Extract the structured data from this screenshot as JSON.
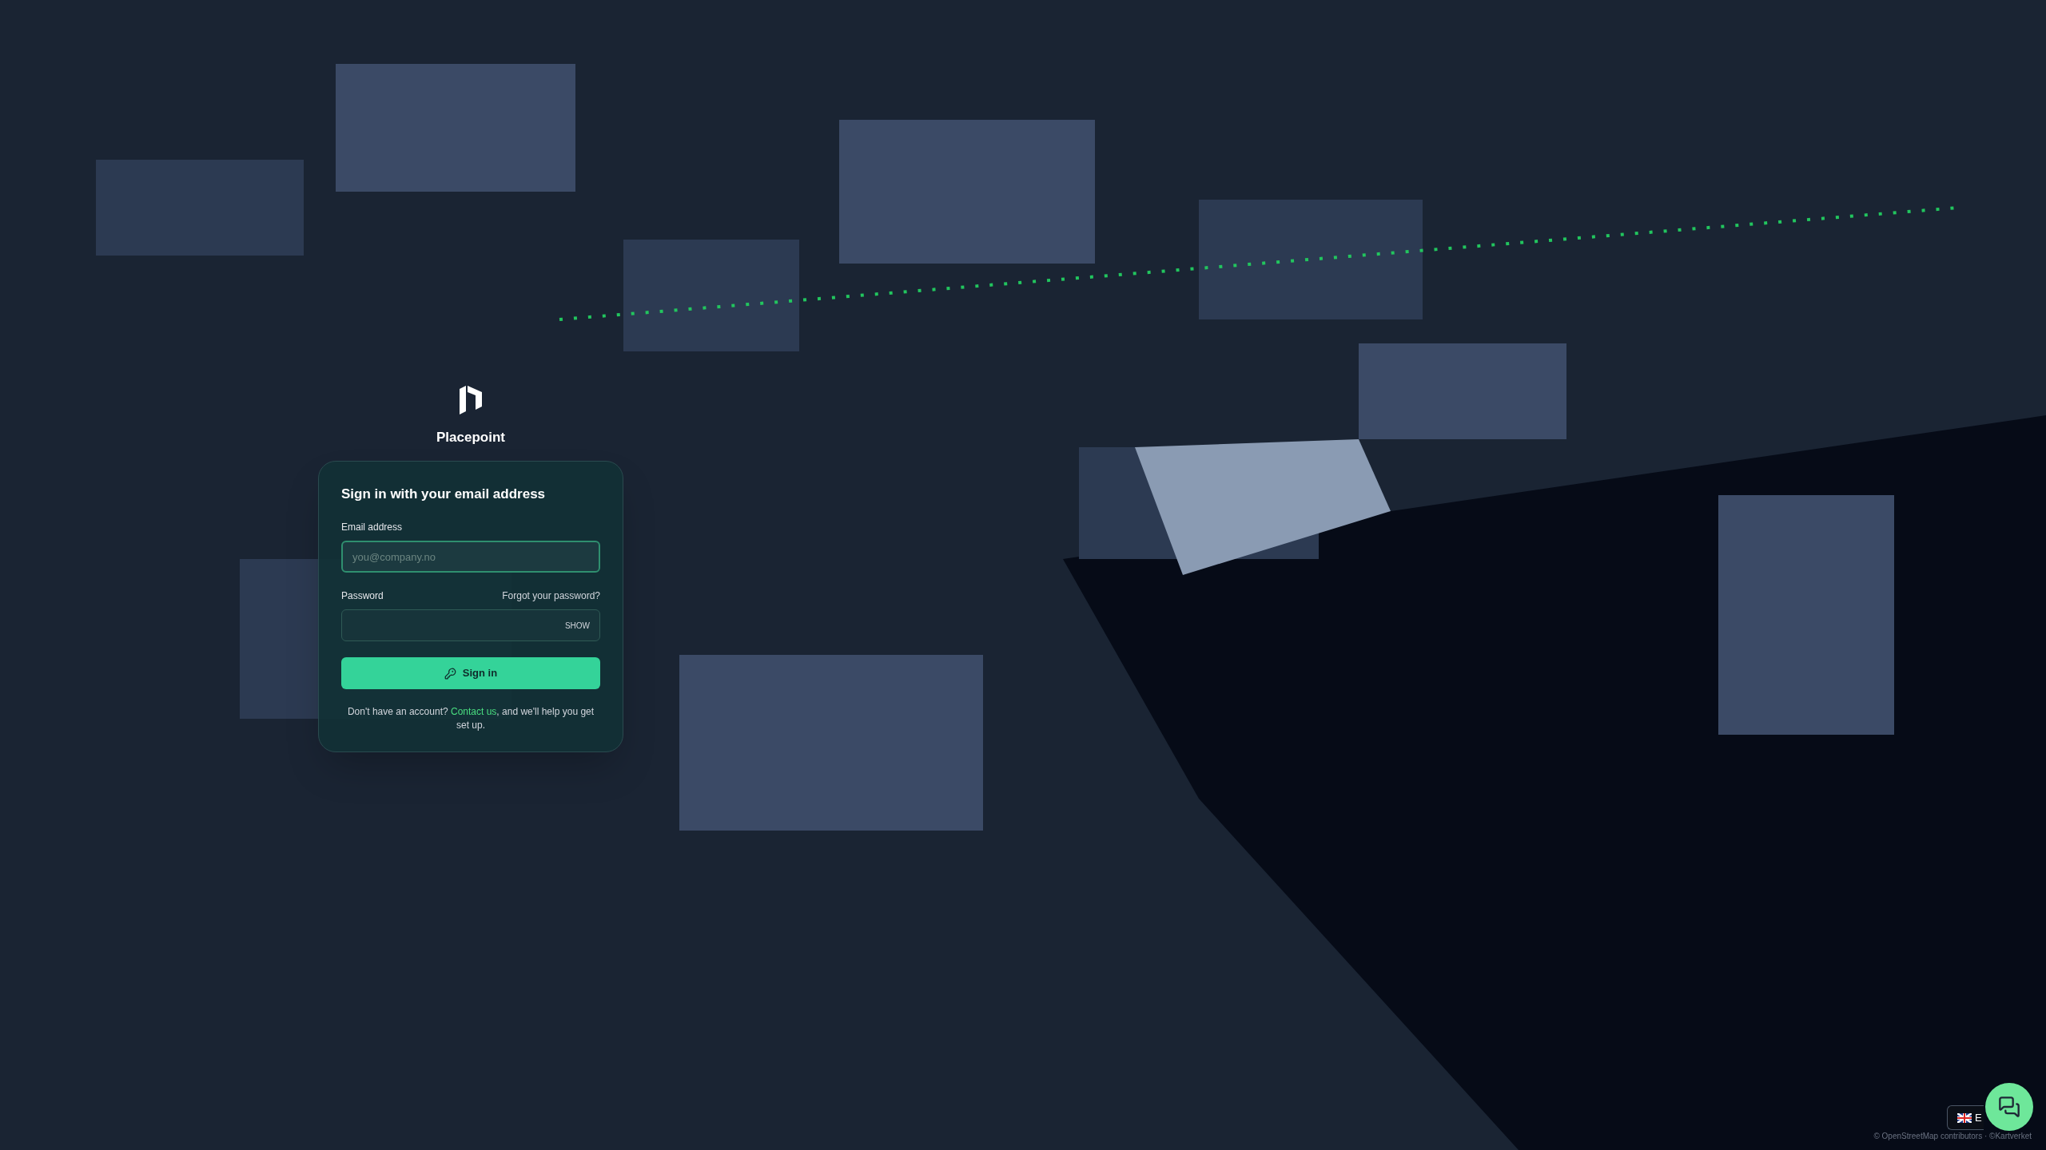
{
  "brand": {
    "name": "Placepoint"
  },
  "signin": {
    "title": "Sign in with your email address",
    "email": {
      "label": "Email address",
      "placeholder": "you@company.no"
    },
    "password": {
      "label": "Password",
      "forgot_link": "Forgot your password?",
      "toggle": "SHOW"
    },
    "submit": "Sign in",
    "footer": {
      "before": "Don't have an account?",
      "link": "Contact us",
      "after": ", and we'll help you get set up."
    }
  },
  "language": {
    "label": "E"
  },
  "attribution": "© OpenStreetMap contributors · ©Kartverket"
}
